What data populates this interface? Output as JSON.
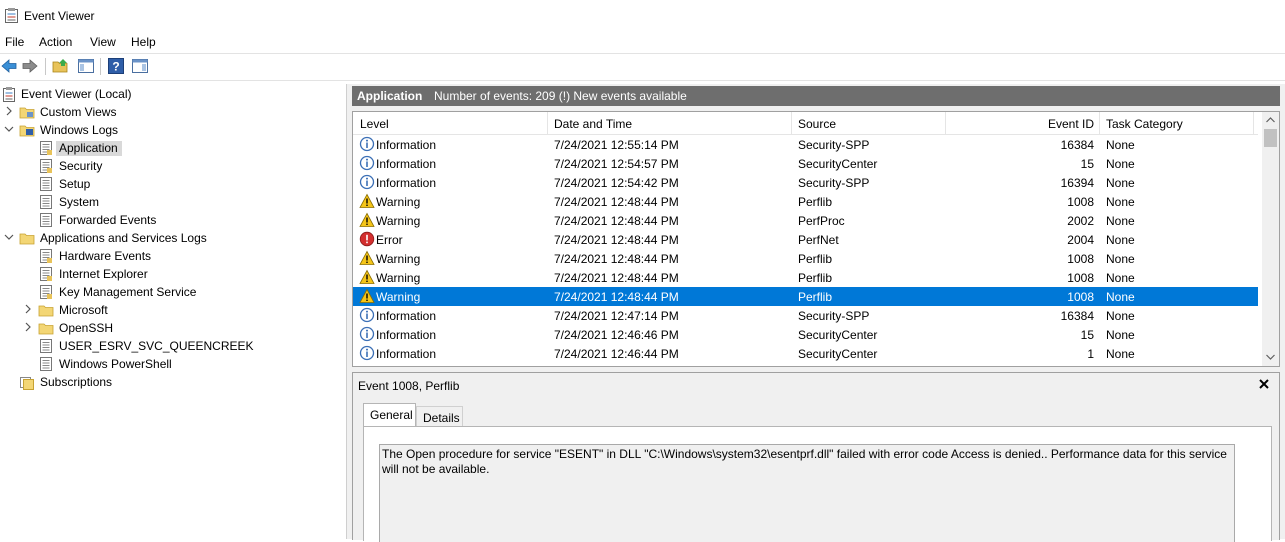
{
  "window": {
    "title": "Event Viewer"
  },
  "menu": [
    "File",
    "Action",
    "View",
    "Help"
  ],
  "tree": {
    "root": "Event Viewer (Local)",
    "custom_views": "Custom Views",
    "windows_logs": "Windows Logs",
    "windows_logs_items": [
      "Application",
      "Security",
      "Setup",
      "System",
      "Forwarded Events"
    ],
    "app_services": "Applications and Services Logs",
    "app_services_items": [
      "Hardware Events",
      "Internet Explorer",
      "Key Management Service",
      "Microsoft",
      "OpenSSH",
      "USER_ESRV_SVC_QUEENCREEK",
      "Windows PowerShell"
    ],
    "subscriptions": "Subscriptions"
  },
  "header": {
    "log_name": "Application",
    "count_text": "Number of events: 209 (!) New events available"
  },
  "columns": [
    "Level",
    "Date and Time",
    "Source",
    "Event ID",
    "Task Category"
  ],
  "events": [
    {
      "level": "Information",
      "datetime": "7/24/2021 12:55:14 PM",
      "source": "Security-SPP",
      "event_id": "16384",
      "task": "None"
    },
    {
      "level": "Information",
      "datetime": "7/24/2021 12:54:57 PM",
      "source": "SecurityCenter",
      "event_id": "15",
      "task": "None"
    },
    {
      "level": "Information",
      "datetime": "7/24/2021 12:54:42 PM",
      "source": "Security-SPP",
      "event_id": "16394",
      "task": "None"
    },
    {
      "level": "Warning",
      "datetime": "7/24/2021 12:48:44 PM",
      "source": "Perflib",
      "event_id": "1008",
      "task": "None"
    },
    {
      "level": "Warning",
      "datetime": "7/24/2021 12:48:44 PM",
      "source": "PerfProc",
      "event_id": "2002",
      "task": "None"
    },
    {
      "level": "Error",
      "datetime": "7/24/2021 12:48:44 PM",
      "source": "PerfNet",
      "event_id": "2004",
      "task": "None"
    },
    {
      "level": "Warning",
      "datetime": "7/24/2021 12:48:44 PM",
      "source": "Perflib",
      "event_id": "1008",
      "task": "None"
    },
    {
      "level": "Warning",
      "datetime": "7/24/2021 12:48:44 PM",
      "source": "Perflib",
      "event_id": "1008",
      "task": "None"
    },
    {
      "level": "Warning",
      "datetime": "7/24/2021 12:48:44 PM",
      "source": "Perflib",
      "event_id": "1008",
      "task": "None"
    },
    {
      "level": "Information",
      "datetime": "7/24/2021 12:47:14 PM",
      "source": "Security-SPP",
      "event_id": "16384",
      "task": "None"
    },
    {
      "level": "Information",
      "datetime": "7/24/2021 12:46:46 PM",
      "source": "SecurityCenter",
      "event_id": "15",
      "task": "None"
    },
    {
      "level": "Information",
      "datetime": "7/24/2021 12:46:44 PM",
      "source": "SecurityCenter",
      "event_id": "1",
      "task": "None"
    }
  ],
  "detail": {
    "title": "Event 1008, Perflib",
    "tabs": [
      "General",
      "Details"
    ],
    "description": "The Open procedure for service \"ESENT\" in DLL \"C:\\Windows\\system32\\esentprf.dll\" failed with error code Access is denied.. Performance data for this service will not be available."
  },
  "colors": {
    "selection": "#0078d7",
    "header_bar": "#6e6e6e",
    "tree_selected": "#d9d9d9"
  }
}
